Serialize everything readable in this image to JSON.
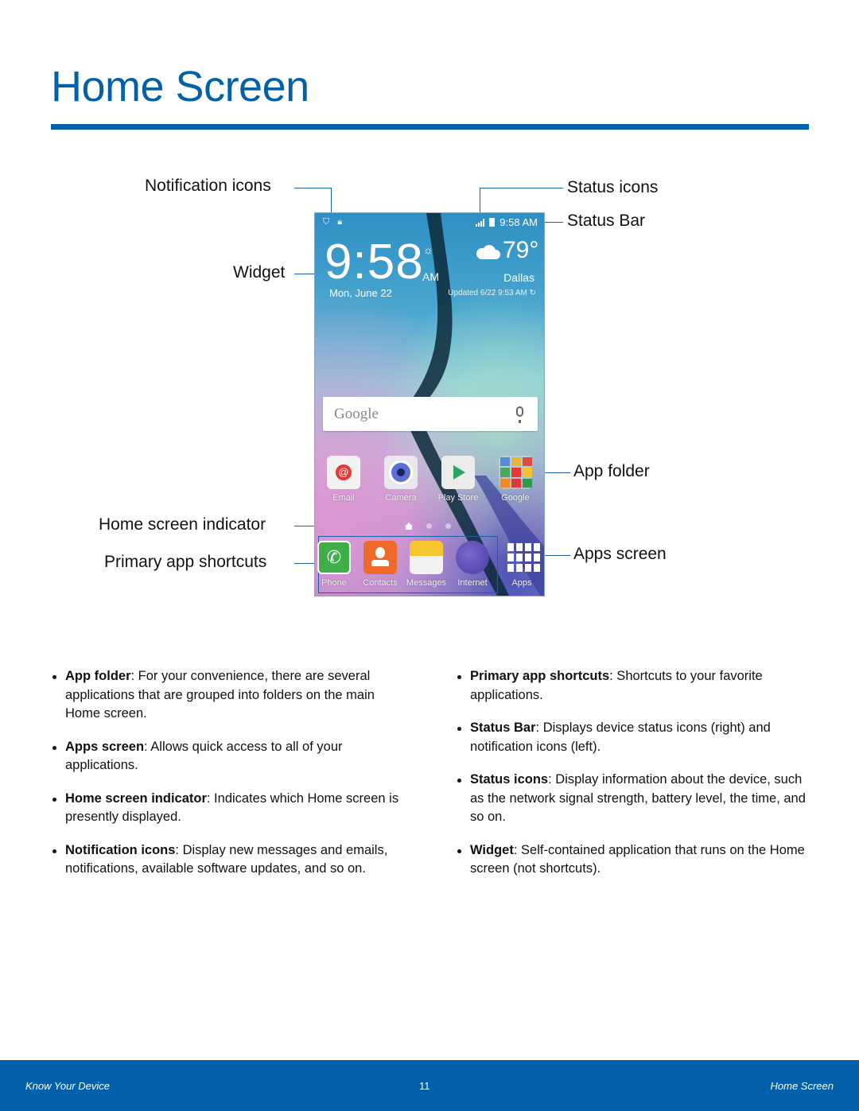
{
  "page": {
    "title": "Home Screen",
    "accent_color": "#0060aa"
  },
  "callouts": {
    "notification_icons": "Notification icons",
    "widget": "Widget",
    "home_screen_indicator": "Home screen indicator",
    "primary_app_shortcuts": "Primary app shortcuts",
    "status_icons": "Status icons",
    "status_bar": "Status Bar",
    "app_folder": "App folder",
    "apps_screen": "Apps screen"
  },
  "phone": {
    "status_bar": {
      "notification_icons": [
        "shield-icon",
        "lock-warning-icon"
      ],
      "status_icons": [
        "signal-icon",
        "battery-icon"
      ],
      "time": "9:58 AM"
    },
    "widget": {
      "clock": "9:58",
      "ampm": "AM",
      "date": "Mon, June 22",
      "temperature": "79°",
      "city": "Dallas",
      "updated": "Updated 6/22 9:53 AM",
      "weather_icon": "cloud-icon"
    },
    "search": {
      "placeholder": "Google",
      "mic_icon": "mic-icon"
    },
    "apps": [
      {
        "label": "Email",
        "icon": "email-icon"
      },
      {
        "label": "Camera",
        "icon": "camera-icon"
      },
      {
        "label": "Play Store",
        "icon": "play-store-icon"
      },
      {
        "label": "Google",
        "icon": "folder-icon"
      }
    ],
    "home_indicator": {
      "pages": 3,
      "current": "home"
    },
    "dock": [
      {
        "label": "Phone",
        "icon": "phone-icon"
      },
      {
        "label": "Contacts",
        "icon": "contacts-icon"
      },
      {
        "label": "Messages",
        "icon": "messages-icon"
      },
      {
        "label": "Internet",
        "icon": "globe-icon"
      },
      {
        "label": "Apps",
        "icon": "apps-grid-icon"
      }
    ]
  },
  "bullets_left": [
    {
      "term": "App folder",
      "text": ": For your convenience, there are several applications that are grouped into folders on the main Home screen."
    },
    {
      "term": "Apps screen",
      "text": ": Allows quick access to all of your applications."
    },
    {
      "term": "Home screen indicator",
      "text": ": Indicates which Home screen is presently displayed."
    },
    {
      "term": "Notification icons",
      "text": ": Display new messages and emails, notifications, available software updates, and so on."
    }
  ],
  "bullets_right": [
    {
      "term": "Primary app shortcuts",
      "text": ": Shortcuts to your favorite applications."
    },
    {
      "term": "Status Bar",
      "text": ": Displays device status icons (right) and notification icons (left)."
    },
    {
      "term": "Status icons",
      "text": ": Display information about the device, such as the network signal strength, battery level, the time, and so on."
    },
    {
      "term": "Widget",
      "text": ": Self-contained application that runs on the Home screen (not shortcuts)."
    }
  ],
  "footer": {
    "section": "Know Your Device",
    "page_number": "11",
    "topic": "Home Screen"
  }
}
